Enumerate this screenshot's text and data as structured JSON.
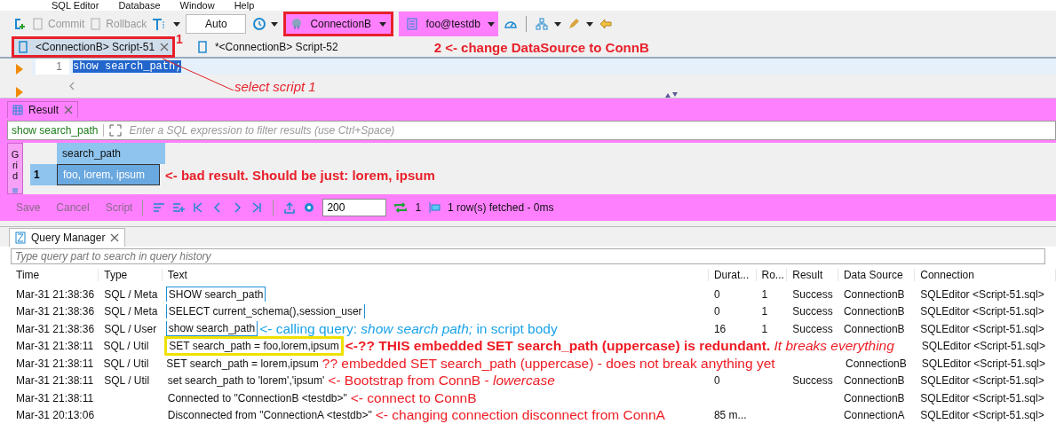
{
  "menu": [
    "SQL Editor",
    "Database",
    "Window",
    "Help"
  ],
  "toolbar": {
    "commit": {
      "label": "Commit",
      "disabled": true
    },
    "rollback": {
      "label": "Rollback",
      "disabled": true
    },
    "mode": "Auto",
    "datasource": {
      "label": "ConnectionB",
      "boxed": true
    },
    "schema": {
      "label": "foo@testdb",
      "boxed": false
    }
  },
  "editor_tabs": [
    {
      "label": "<ConnectionB> Script-51",
      "selected": true,
      "boxed": true
    },
    {
      "label": "*<ConnectionB> Script-52",
      "selected": false,
      "boxed": false
    }
  ],
  "editor": {
    "lines": [
      {
        "number": "1",
        "text": "show search_path;",
        "selected": true
      }
    ]
  },
  "annotations": {
    "step1": "1",
    "step2": "2 <- change DataSource to ConnB",
    "select_script": "select script 1",
    "bad_result": "<- bad result. Should be just: lorem, ipsum"
  },
  "result": {
    "tab": "Result",
    "query": "show search_path",
    "filter_placeholder": "Enter a SQL expression to filter results (use Ctrl+Space)",
    "side_tab": "Grid",
    "columns": [
      "search_path"
    ],
    "rows": [
      {
        "number": "1",
        "cells": [
          "foo, lorem, ipsum"
        ],
        "selected": true
      }
    ],
    "actions": [
      {
        "label": "Save",
        "disabled": true
      },
      {
        "label": "Cancel",
        "disabled": true
      },
      {
        "label": "Script",
        "disabled": true
      }
    ],
    "fetch_size": "200",
    "fetched_count": "1",
    "status": "1 row(s) fetched - 0ms"
  },
  "query_manager": {
    "tab": "Query Manager",
    "search_placeholder": "Type query part to search in query history",
    "columns": [
      "Time",
      "Type",
      "Text",
      "Durat...",
      "Ro...",
      "Result",
      "Data Source",
      "Connection"
    ],
    "rows": [
      {
        "cells": [
          "Mar-31 21:38:36",
          "SQL / Meta",
          "SHOW search_path",
          "0",
          "1",
          "Success",
          "ConnectionB",
          "SQLEditor <Script-51.sql>"
        ],
        "color": "#1e8fd6"
      },
      {
        "cells": [
          "Mar-31 21:38:36",
          "SQL / Meta",
          "SELECT current_schema(),session_user",
          "0",
          "1",
          "Success",
          "ConnectionB",
          "SQLEditor <Script-51.sql>"
        ],
        "color": "#1e8fd6"
      },
      {
        "cells": [
          "Mar-31 21:38:36",
          "SQL / User",
          "show search_path",
          "16",
          "1",
          "Success",
          "ConnectionB",
          "SQLEditor <Script-51.sql>"
        ],
        "color": "#1e8fd6",
        "annotation": {
          "text": "<- calling query: *show search path;* in script body",
          "color": "#1aa3e8"
        }
      },
      {
        "cells": [
          "Mar-31 21:38:11",
          "SQL / Util",
          "SET search_path = foo,lorem,ipsum",
          "",
          "",
          "",
          "",
          "SQLEditor <Script-51.sql>"
        ],
        "color": "#f0e000",
        "annotation": {
          "text": "**<-?? THIS embedded SET search_path (uppercase) is redundant.** *It breaks everything*",
          "color": "#ee1c24"
        }
      },
      {
        "cells": [
          "Mar-31 21:38:11",
          "SQL / Util",
          "SET search_path = lorem,ipsum",
          "",
          "",
          "",
          "ConnectionB",
          "SQLEditor <Script-51.sql>"
        ],
        "annotation": {
          "text": "?? embedded SET search_path (uppercase) - does not break anything yet",
          "color": "#ee1c24"
        }
      },
      {
        "cells": [
          "Mar-31 21:38:11",
          "SQL / Util",
          "set search_path to 'lorem','ipsum'",
          "0",
          "",
          "Success",
          "ConnectionB",
          "SQLEditor <Script-51.sql>"
        ],
        "annotation": {
          "text": "<- Bootstrap from ConnB - *lowercase*",
          "color": "#ee1c24"
        }
      },
      {
        "cells": [
          "Mar-31 21:38:11",
          "",
          "Connected to \"ConnectionB <testdb>\"",
          "",
          "",
          "",
          "ConnectionB",
          "SQLEditor <Script-51.sql>"
        ],
        "annotation": {
          "text": "<- connect to ConnB",
          "color": "#ee1c24"
        }
      },
      {
        "cells": [
          "Mar-31 20:13:06",
          "",
          "Disconnected from \"ConnectionA <testdb>\"",
          "85 m...",
          "",
          "",
          "ConnectionA",
          "SQLEditor <Script-51.sql>"
        ],
        "annotation": {
          "text": "<- changing connection disconnect from ConnA",
          "color": "#ee1c24"
        }
      }
    ]
  }
}
